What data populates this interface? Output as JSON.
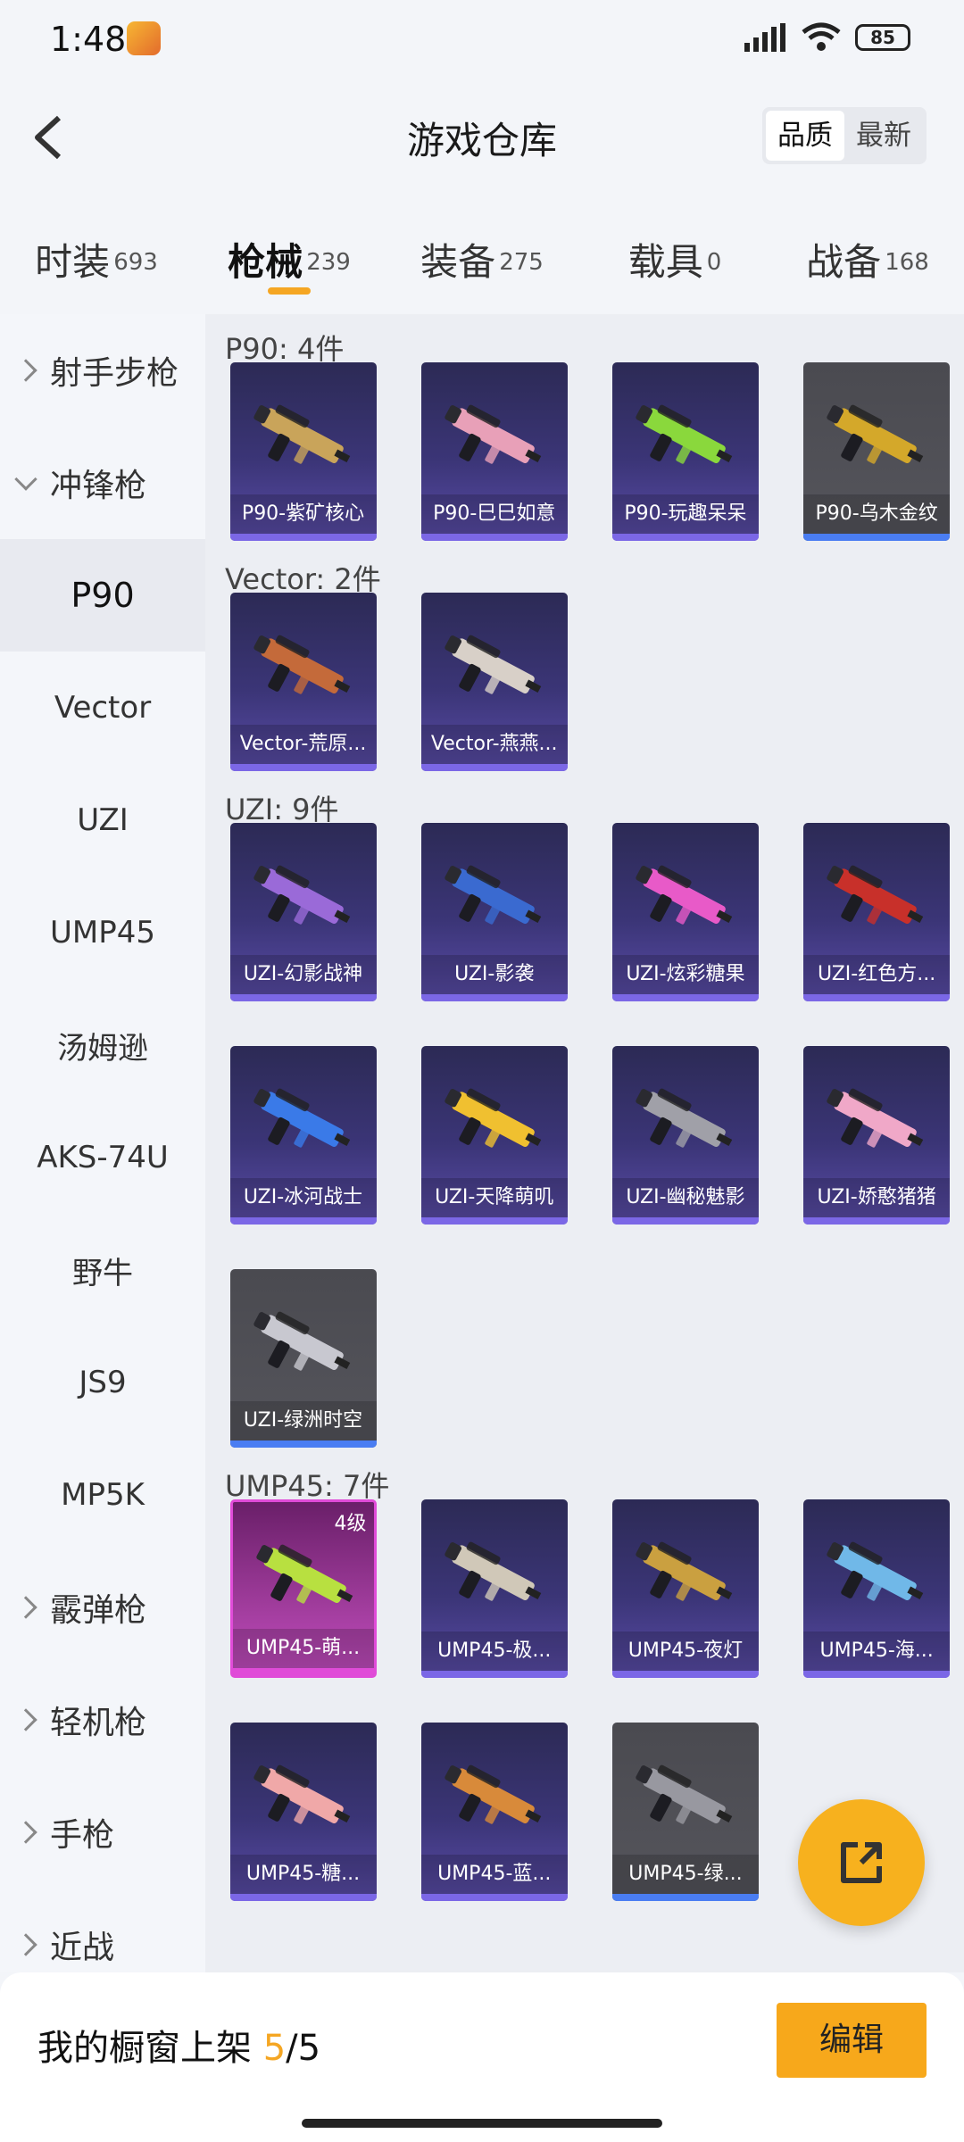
{
  "status": {
    "time": "1:48",
    "battery": "85"
  },
  "header": {
    "title": "游戏仓库",
    "sort_options": [
      "品质",
      "最新"
    ],
    "sort_active": "品质"
  },
  "categories": [
    {
      "label": "时装",
      "count": "693"
    },
    {
      "label": "枪械",
      "count": "239"
    },
    {
      "label": "装备",
      "count": "275"
    },
    {
      "label": "载具",
      "count": "0"
    },
    {
      "label": "战备",
      "count": "168"
    }
  ],
  "sidebar": [
    {
      "label": "射手步枪",
      "type": "group"
    },
    {
      "label": "冲锋枪",
      "type": "group_open"
    },
    {
      "label": "P90",
      "type": "sub_selected"
    },
    {
      "label": "Vector",
      "type": "sub"
    },
    {
      "label": "UZI",
      "type": "sub"
    },
    {
      "label": "UMP45",
      "type": "sub"
    },
    {
      "label": "汤姆逊",
      "type": "sub"
    },
    {
      "label": "AKS-74U",
      "type": "sub"
    },
    {
      "label": "野牛",
      "type": "sub"
    },
    {
      "label": "JS9",
      "type": "sub"
    },
    {
      "label": "MP5K",
      "type": "sub"
    },
    {
      "label": "霰弹枪",
      "type": "group"
    },
    {
      "label": "轻机枪",
      "type": "group"
    },
    {
      "label": "手枪",
      "type": "group"
    },
    {
      "label": "近战",
      "type": "group"
    }
  ],
  "sections": [
    {
      "title": "P90: 4件",
      "items": [
        {
          "name": "P90-紫矿核心",
          "style": "purple",
          "color": "#c9a45a"
        },
        {
          "name": "P90-巳巳如意",
          "style": "purple",
          "color": "#e8a0b8"
        },
        {
          "name": "P90-玩趣呆呆",
          "style": "purple",
          "color": "#8ad83c"
        },
        {
          "name": "P90-乌木金纹",
          "style": "grey",
          "color": "#d4a82a"
        }
      ]
    },
    {
      "title": "Vector: 2件",
      "items": [
        {
          "name": "Vector-荒原...",
          "style": "purple",
          "color": "#c46a3a"
        },
        {
          "name": "Vector-燕燕...",
          "style": "purple",
          "color": "#d8d0c8"
        }
      ]
    },
    {
      "title": "UZI: 9件",
      "items": [
        {
          "name": "UZI-幻影战神",
          "style": "purple",
          "color": "#9a6ad8"
        },
        {
          "name": "UZI-影袭",
          "style": "purple",
          "color": "#3a6ad0"
        },
        {
          "name": "UZI-炫彩糖果",
          "style": "purple",
          "color": "#e85ac8"
        },
        {
          "name": "UZI-红色方...",
          "style": "purple",
          "color": "#c8302a"
        },
        {
          "name": "UZI-冰河战士",
          "style": "purple",
          "color": "#3a7ae8"
        },
        {
          "name": "UZI-天降萌叽",
          "style": "purple",
          "color": "#f0c030"
        },
        {
          "name": "UZI-幽秘魅影",
          "style": "purple",
          "color": "#a0a0a8"
        },
        {
          "name": "UZI-娇憨猪猪",
          "style": "purple",
          "color": "#f0a8c8"
        },
        {
          "name": "UZI-绿洲时空",
          "style": "grey",
          "color": "#c8c8d0"
        }
      ]
    },
    {
      "title": "UMP45: 7件",
      "items": [
        {
          "name": "UMP45-萌...",
          "style": "pink",
          "color": "#b8e040",
          "level": "4级"
        },
        {
          "name": "UMP45-极...",
          "style": "purple",
          "color": "#d0c8b8"
        },
        {
          "name": "UMP45-夜灯",
          "style": "purple",
          "color": "#caa040"
        },
        {
          "name": "UMP45-海...",
          "style": "purple",
          "color": "#70b8e8"
        },
        {
          "name": "UMP45-糖...",
          "style": "purple",
          "color": "#f0a8a8"
        },
        {
          "name": "UMP45-蓝...",
          "style": "purple",
          "color": "#d88a3a"
        },
        {
          "name": "UMP45-绿...",
          "style": "grey",
          "color": "#9898a0"
        }
      ]
    }
  ],
  "showcase": {
    "label": "我的橱窗上架",
    "current": "5",
    "total": "/5",
    "edit_label": "编辑"
  }
}
